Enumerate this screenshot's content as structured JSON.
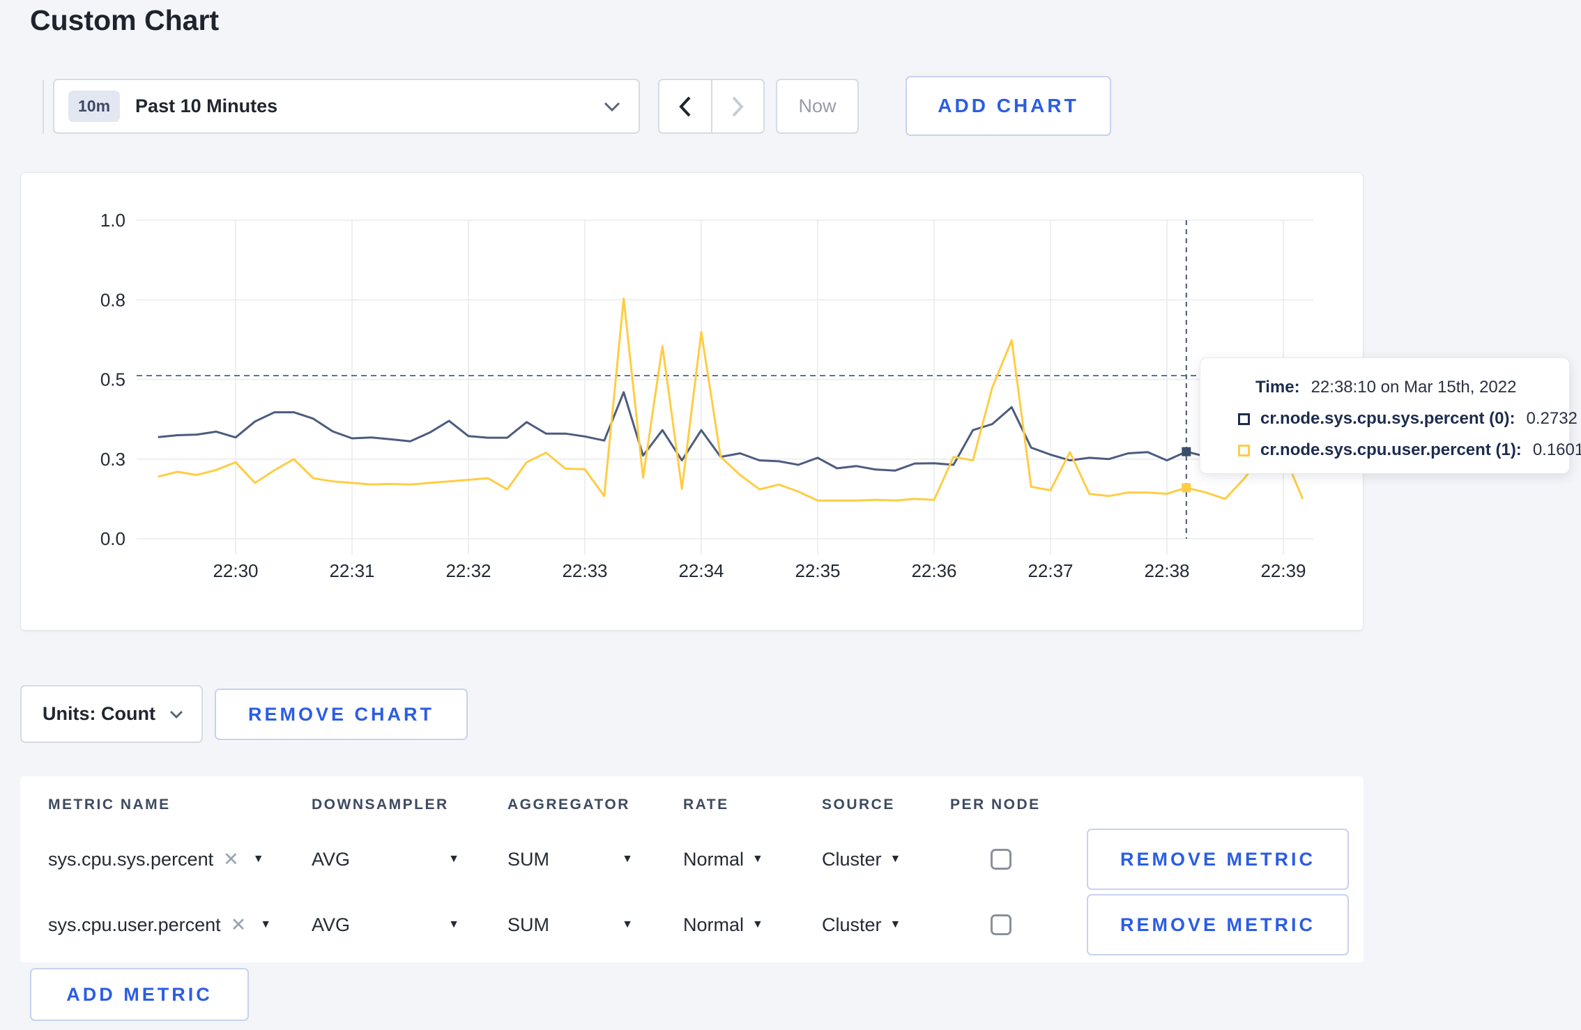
{
  "title": "Custom Chart",
  "toolbar": {
    "range_badge": "10m",
    "range_label": "Past 10 Minutes",
    "now_label": "Now",
    "add_chart_label": "ADD CHART"
  },
  "chart_data": {
    "type": "line",
    "x_start": "22:29:20",
    "x_interval_seconds": 10,
    "x_tick_labels": [
      "22:30",
      "22:31",
      "22:32",
      "22:33",
      "22:34",
      "22:35",
      "22:36",
      "22:37",
      "22:38",
      "22:39"
    ],
    "y_ticks": [
      {
        "label": "0.0",
        "value": 0.0
      },
      {
        "label": "0.3",
        "value": 0.25
      },
      {
        "label": "0.5",
        "value": 0.5
      },
      {
        "label": "0.8",
        "value": 0.75
      },
      {
        "label": "1.0",
        "value": 1.0
      }
    ],
    "ylim": [
      0,
      1
    ],
    "grid": true,
    "threshold_line_value": 0.512,
    "crosshair_index": 53,
    "crosshair_time": "22:38:10",
    "series": [
      {
        "name": "cr.node.sys.cpu.sys.percent (0)",
        "color": "#4c5c7e",
        "values": [
          0.319,
          0.325,
          0.327,
          0.336,
          0.318,
          0.368,
          0.397,
          0.397,
          0.377,
          0.337,
          0.315,
          0.318,
          0.312,
          0.306,
          0.333,
          0.37,
          0.322,
          0.317,
          0.317,
          0.366,
          0.33,
          0.33,
          0.321,
          0.308,
          0.46,
          0.261,
          0.341,
          0.246,
          0.341,
          0.257,
          0.268,
          0.246,
          0.243,
          0.232,
          0.254,
          0.221,
          0.228,
          0.217,
          0.214,
          0.236,
          0.237,
          0.232,
          0.341,
          0.36,
          0.413,
          0.286,
          0.264,
          0.246,
          0.254,
          0.25,
          0.268,
          0.272,
          0.246,
          0.2732,
          0.258,
          0.263,
          0.282,
          0.298,
          0.312,
          0.3
        ]
      },
      {
        "name": "cr.node.sys.cpu.user.percent (1)",
        "color": "#ffcd44",
        "values": [
          0.195,
          0.21,
          0.2,
          0.216,
          0.24,
          0.175,
          0.215,
          0.25,
          0.19,
          0.18,
          0.175,
          0.17,
          0.172,
          0.17,
          0.175,
          0.18,
          0.185,
          0.19,
          0.155,
          0.24,
          0.27,
          0.22,
          0.218,
          0.134,
          0.754,
          0.192,
          0.605,
          0.156,
          0.649,
          0.257,
          0.2,
          0.155,
          0.17,
          0.148,
          0.12,
          0.12,
          0.12,
          0.122,
          0.12,
          0.125,
          0.122,
          0.257,
          0.246,
          0.475,
          0.623,
          0.163,
          0.152,
          0.272,
          0.141,
          0.134,
          0.145,
          0.145,
          0.141,
          0.1601,
          0.145,
          0.125,
          0.19,
          0.27,
          0.27,
          0.125
        ]
      }
    ]
  },
  "tooltip": {
    "time_label": "Time:",
    "time_value": "22:38:10 on Mar 15th, 2022",
    "rows": [
      {
        "name": "cr.node.sys.cpu.sys.percent (0):",
        "value": "0.2732",
        "color": "#1d2c4e"
      },
      {
        "name": "cr.node.sys.cpu.user.percent (1):",
        "value": "0.1601",
        "color": "#ffcd44"
      }
    ]
  },
  "units": {
    "label": "Units: Count"
  },
  "actions": {
    "remove_chart": "REMOVE CHART",
    "add_metric": "ADD METRIC",
    "remove_metric": "REMOVE METRIC"
  },
  "table": {
    "headers": [
      "METRIC NAME",
      "DOWNSAMPLER",
      "AGGREGATOR",
      "RATE",
      "SOURCE",
      "PER NODE"
    ],
    "rows": [
      {
        "metric": "sys.cpu.sys.percent",
        "downsampler": "AVG",
        "aggregator": "SUM",
        "rate": "Normal",
        "source": "Cluster",
        "per_node_checked": false
      },
      {
        "metric": "sys.cpu.user.percent",
        "downsampler": "AVG",
        "aggregator": "SUM",
        "rate": "Normal",
        "source": "Cluster",
        "per_node_checked": false
      }
    ]
  },
  "colors": {
    "accent_blue": "#2b5de4",
    "series_sys": "#4c5c7e",
    "series_user": "#ffcd44",
    "crosshair": "#475872",
    "gridline": "#e8eaef"
  }
}
